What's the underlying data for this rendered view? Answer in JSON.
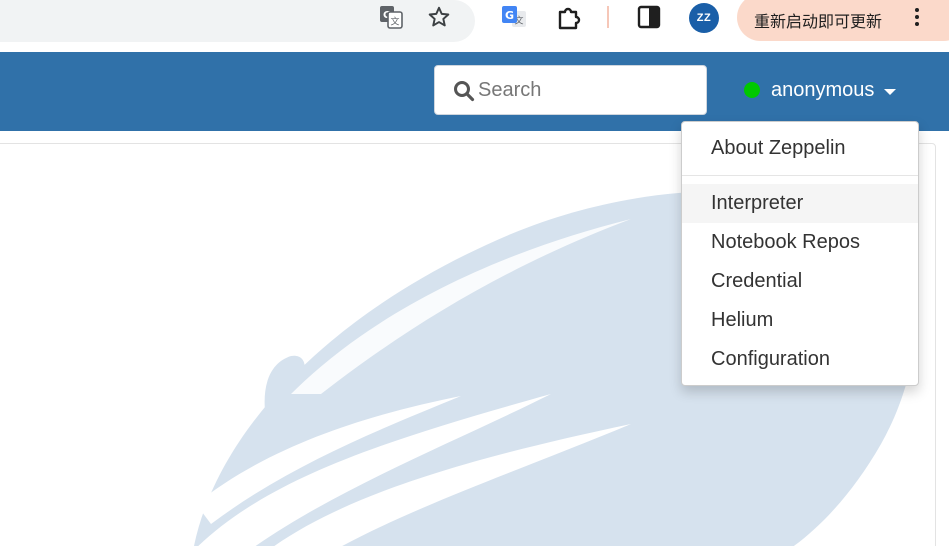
{
  "browser": {
    "update_button_label": "重新启动即可更新",
    "profile_initials": "ZZ",
    "icons": [
      "translate-icon",
      "bookmark-star-icon",
      "google-translate-extension-icon",
      "extensions-puzzle-icon",
      "side-panel-icon",
      "more-menu-icon"
    ]
  },
  "navbar": {
    "background_color": "#3071a9",
    "search": {
      "placeholder": "Search",
      "value": ""
    },
    "user": {
      "name": "anonymous",
      "status_color": "#00c800"
    }
  },
  "user_dropdown": {
    "header_item": "About Zeppelin",
    "items": [
      {
        "label": "Interpreter",
        "highlighted": true
      },
      {
        "label": "Notebook Repos",
        "highlighted": false
      },
      {
        "label": "Credential",
        "highlighted": false
      },
      {
        "label": "Helium",
        "highlighted": false
      },
      {
        "label": "Configuration",
        "highlighted": false
      }
    ]
  },
  "content": {
    "logo_color": "#d6e2ee"
  }
}
